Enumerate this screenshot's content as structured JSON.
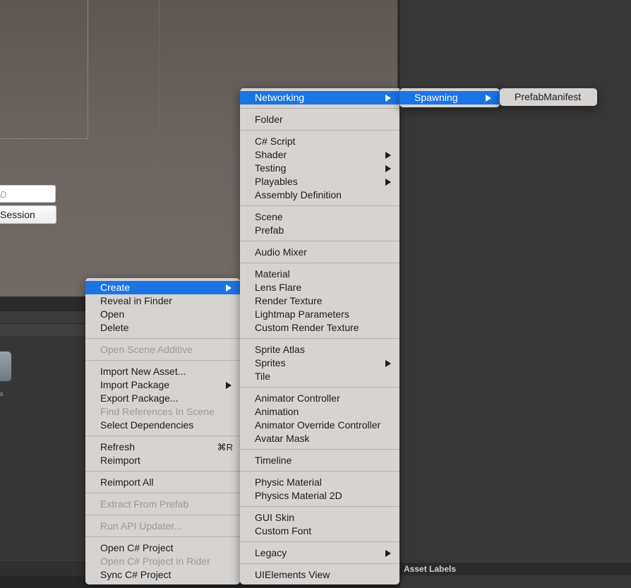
{
  "scene": {
    "input_placeholder": "D",
    "session_button": "Session"
  },
  "asset_labels": "Asset Labels",
  "asset_thumb_label": "s",
  "context_menu": [
    {
      "label": "Create",
      "submenu": true,
      "active": true
    },
    {
      "label": "Reveal in Finder"
    },
    {
      "label": "Open"
    },
    {
      "label": "Delete"
    },
    {
      "sep": true
    },
    {
      "label": "Open Scene Additive",
      "disabled": true
    },
    {
      "sep": true
    },
    {
      "label": "Import New Asset..."
    },
    {
      "label": "Import Package",
      "submenu": true
    },
    {
      "label": "Export Package..."
    },
    {
      "label": "Find References In Scene",
      "disabled": true
    },
    {
      "label": "Select Dependencies"
    },
    {
      "sep": true
    },
    {
      "label": "Refresh",
      "shortcut": "⌘R"
    },
    {
      "label": "Reimport"
    },
    {
      "sep": true
    },
    {
      "label": "Reimport All"
    },
    {
      "sep": true
    },
    {
      "label": "Extract From Prefab",
      "disabled": true
    },
    {
      "sep": true
    },
    {
      "label": "Run API Updater...",
      "disabled": true
    },
    {
      "sep": true
    },
    {
      "label": "Open C# Project"
    },
    {
      "label": "Open C# Project in Rider",
      "disabled": true
    },
    {
      "label": "Sync C# Project"
    }
  ],
  "create_menu": [
    {
      "label": "Networking",
      "submenu": true,
      "active": true
    },
    {
      "sep": true
    },
    {
      "label": "Folder"
    },
    {
      "sep": true
    },
    {
      "label": "C# Script"
    },
    {
      "label": "Shader",
      "submenu": true
    },
    {
      "label": "Testing",
      "submenu": true
    },
    {
      "label": "Playables",
      "submenu": true
    },
    {
      "label": "Assembly Definition"
    },
    {
      "sep": true
    },
    {
      "label": "Scene"
    },
    {
      "label": "Prefab"
    },
    {
      "sep": true
    },
    {
      "label": "Audio Mixer"
    },
    {
      "sep": true
    },
    {
      "label": "Material"
    },
    {
      "label": "Lens Flare"
    },
    {
      "label": "Render Texture"
    },
    {
      "label": "Lightmap Parameters"
    },
    {
      "label": "Custom Render Texture"
    },
    {
      "sep": true
    },
    {
      "label": "Sprite Atlas"
    },
    {
      "label": "Sprites",
      "submenu": true
    },
    {
      "label": "Tile"
    },
    {
      "sep": true
    },
    {
      "label": "Animator Controller"
    },
    {
      "label": "Animation"
    },
    {
      "label": "Animator Override Controller"
    },
    {
      "label": "Avatar Mask"
    },
    {
      "sep": true
    },
    {
      "label": "Timeline"
    },
    {
      "sep": true
    },
    {
      "label": "Physic Material"
    },
    {
      "label": "Physics Material 2D"
    },
    {
      "sep": true
    },
    {
      "label": "GUI Skin"
    },
    {
      "label": "Custom Font"
    },
    {
      "sep": true
    },
    {
      "label": "Legacy",
      "submenu": true
    },
    {
      "sep": true
    },
    {
      "label": "UIElements View"
    }
  ],
  "networking_menu": [
    {
      "label": "Spawning",
      "submenu": true,
      "active": true
    }
  ],
  "spawning_menu": [
    {
      "label": "PrefabManifest"
    }
  ]
}
